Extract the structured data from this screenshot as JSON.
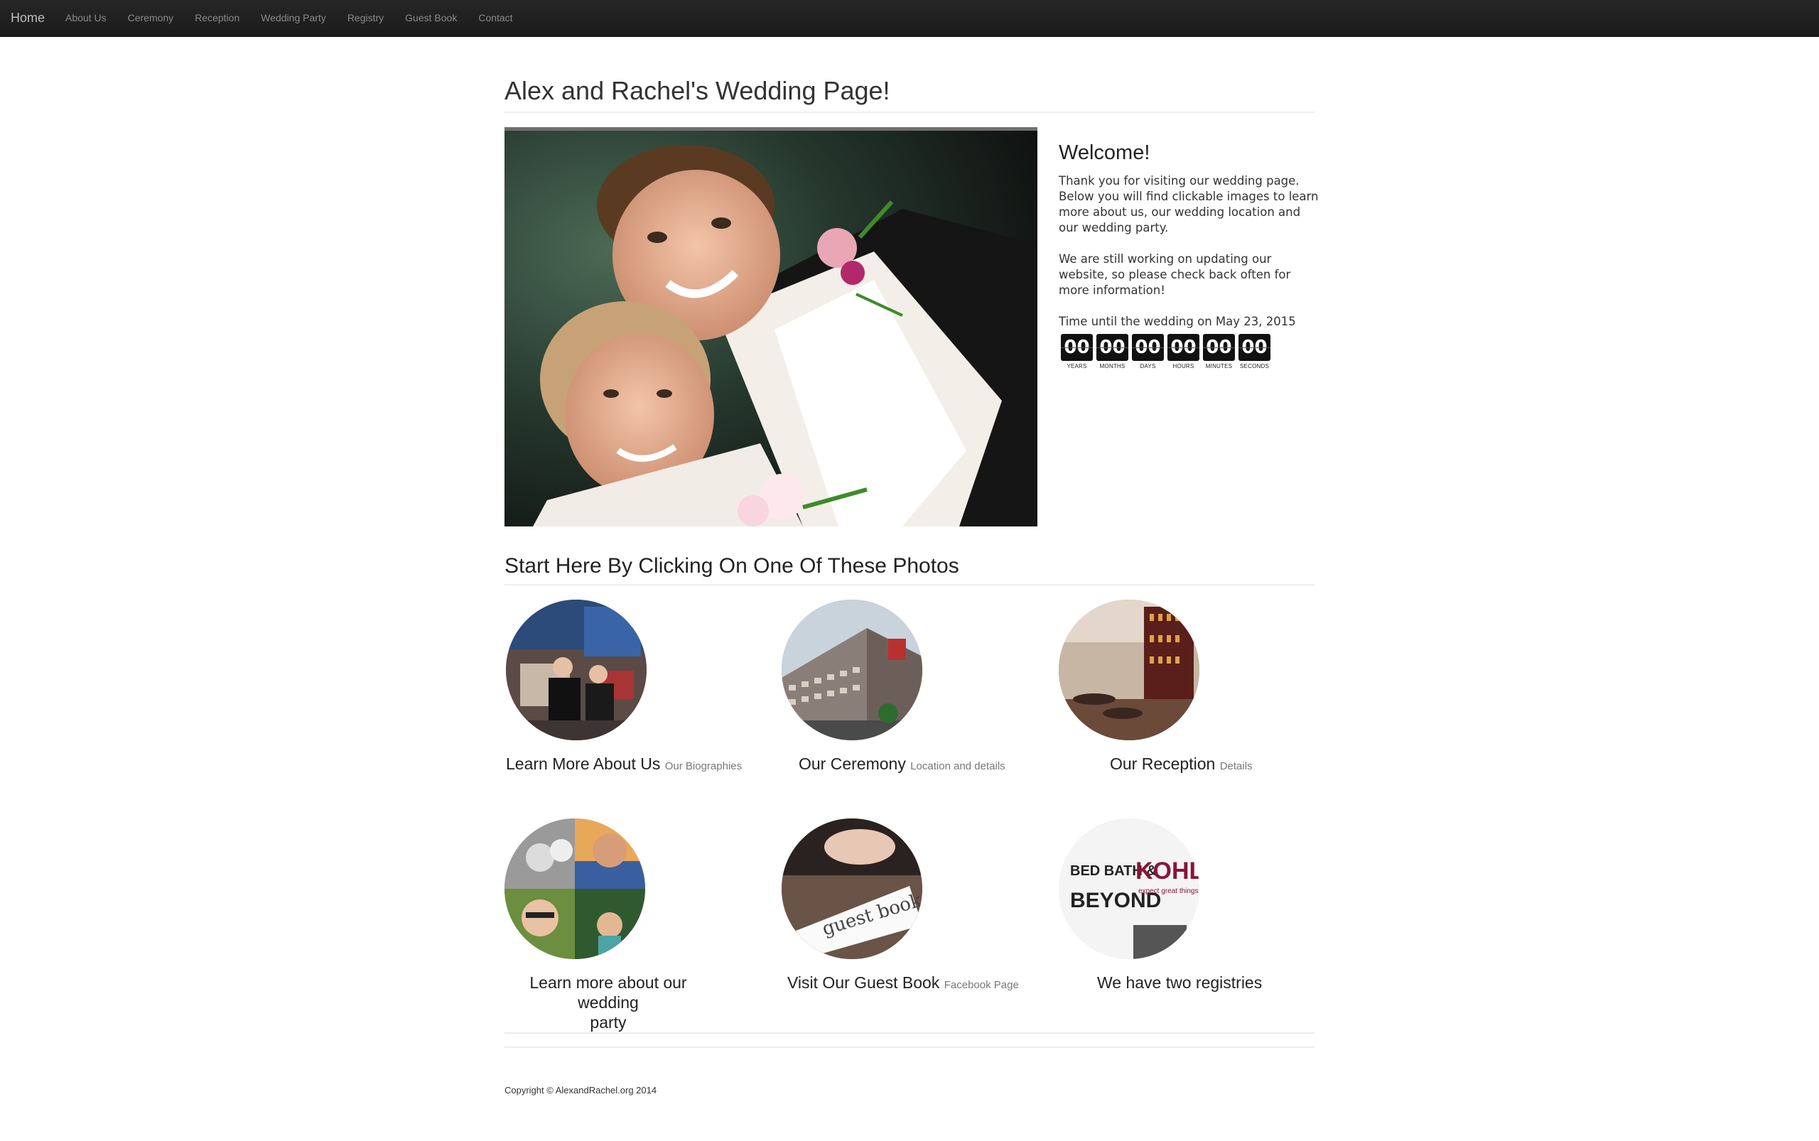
{
  "nav": {
    "brand": "Home",
    "items": [
      "About Us",
      "Ceremony",
      "Reception",
      "Wedding Party",
      "Registry",
      "Guest Book",
      "Contact"
    ]
  },
  "page": {
    "title": "Alex and Rachel's Wedding Page!"
  },
  "welcome": {
    "heading": "Welcome!",
    "para1": "Thank you for visiting our wedding page. Below you will find clickable images to learn more about us, our wedding location and our wedding party.",
    "para2": "We are still working on updating our website, so please check back often for more information!",
    "countdown_label": "Time until the wedding on May 23, 2015"
  },
  "countdown": [
    {
      "value": "00",
      "label": "YEARS"
    },
    {
      "value": "00",
      "label": "MONTHS"
    },
    {
      "value": "00",
      "label": "DAYS"
    },
    {
      "value": "00",
      "label": "HOURS"
    },
    {
      "value": "00",
      "label": "MINUTES"
    },
    {
      "value": "00",
      "label": "SECONDS"
    }
  ],
  "section": {
    "title": "Start Here By Clicking On One Of These Photos"
  },
  "tiles": [
    {
      "title": "Learn More About Us",
      "sub": "Our Biographies"
    },
    {
      "title": "Our Ceremony",
      "sub": "Location and details"
    },
    {
      "title": "Our Reception",
      "sub": "Details"
    },
    {
      "title": "Learn more about our wedding",
      "title2": "party",
      "sub": ""
    },
    {
      "title": "Visit Our Guest Book",
      "sub": "Facebook Page"
    },
    {
      "title": "We have two registries",
      "sub": ""
    }
  ],
  "registry_logos": {
    "left": "BED BATH & BEYOND",
    "right": "KOHL'S",
    "right_tag": "expect great things"
  },
  "guestbook_sign": "guest book",
  "footer": {
    "copyright": "Copyright © AlexandRachel.org 2014"
  }
}
